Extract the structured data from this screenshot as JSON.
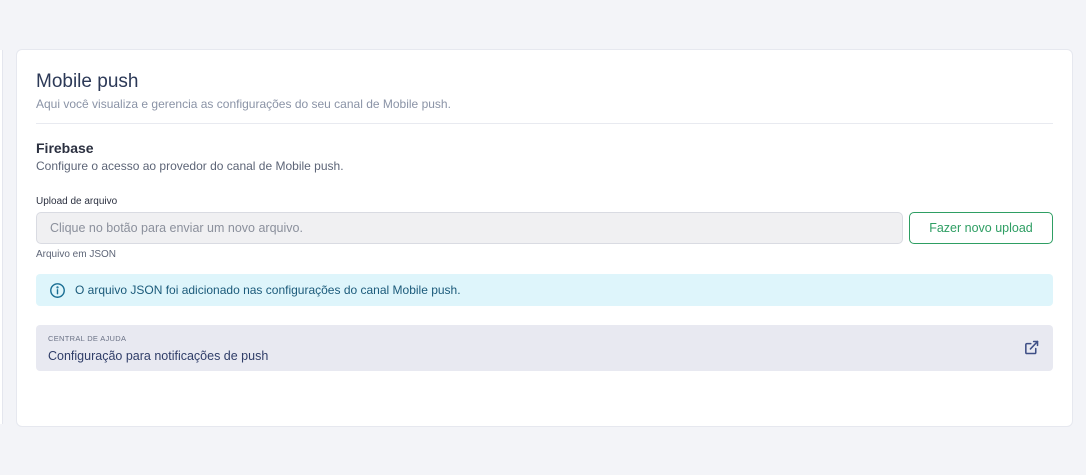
{
  "page": {
    "title": "Mobile push",
    "subtitle": "Aqui você visualiza e gerencia as configurações do seu canal de Mobile push."
  },
  "firebase": {
    "title": "Firebase",
    "subtitle": "Configure o acesso ao provedor do canal de Mobile push.",
    "upload": {
      "label": "Upload de arquivo",
      "placeholder": "Clique no botão para enviar um novo arquivo.",
      "value": "",
      "button_label": "Fazer novo upload",
      "helper": "Arquivo em JSON"
    },
    "alert": {
      "icon": "info-circle-icon",
      "text": "O arquivo JSON foi adicionado nas configurações do canal Mobile push."
    }
  },
  "help_center": {
    "eyebrow": "CENTRAL DE AJUDA",
    "link_text": "Configuração para notificações de push",
    "icon": "external-link-icon"
  },
  "colors": {
    "accent_green": "#2e9e63",
    "info_bg": "#def5fb",
    "info_text": "#1b5a7a",
    "help_bg": "#e8e9f1"
  }
}
